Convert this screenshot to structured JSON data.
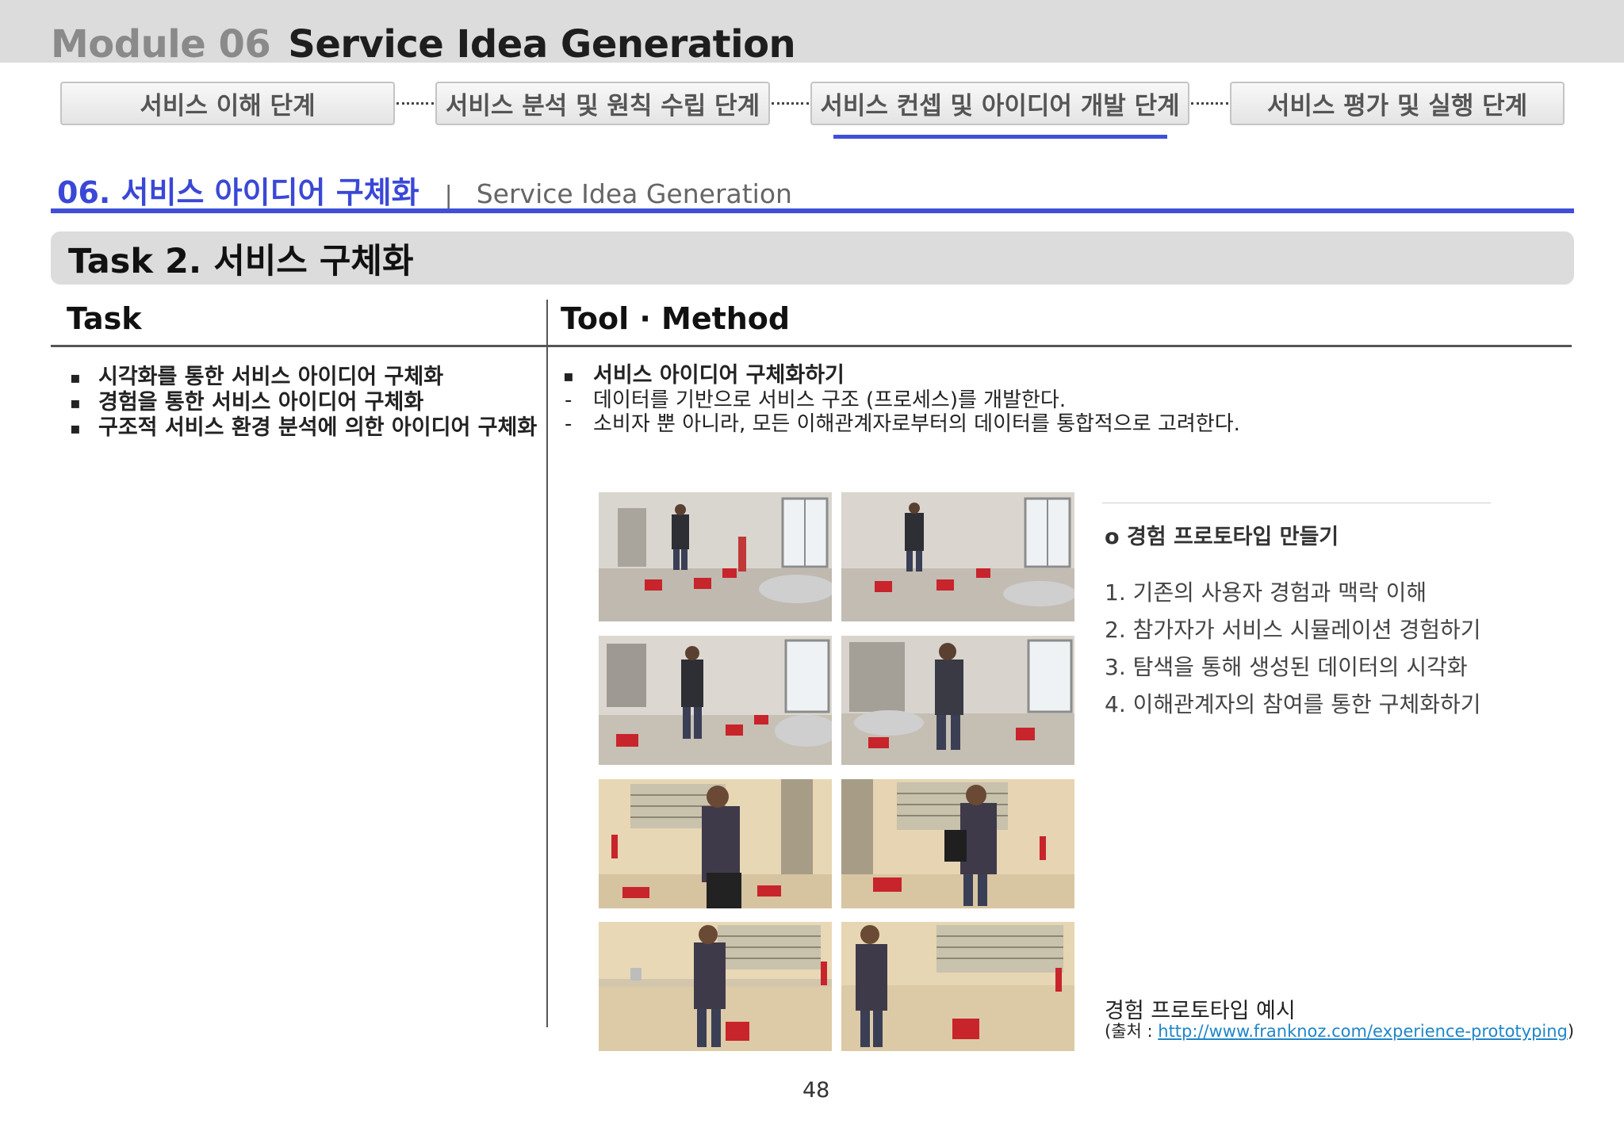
{
  "header": {
    "module_number": "Module 06",
    "module_name": "Service Idea Generation"
  },
  "process_steps": [
    {
      "label": "서비스 이해 단계",
      "active": false
    },
    {
      "label": "서비스 분석 및 원칙 수립 단계",
      "active": false
    },
    {
      "label": "서비스 컨셉 및 아이디어 개발 단계",
      "active": true
    },
    {
      "label": "서비스 평가 및 실행 단계",
      "active": false
    }
  ],
  "section": {
    "title": "06. 서비스 아이디어 구체화",
    "separator": "|",
    "subtitle": "Service Idea Generation"
  },
  "task_bar": {
    "title": "Task 2. 서비스 구체화"
  },
  "columns": {
    "task": "Task",
    "tool_method": "Tool · Method"
  },
  "tasks": [
    "시각화를 통한 서비스 아이디어 구체화",
    "경험을 통한 서비스 아이디어 구체화",
    "구조적 서비스 환경 분석에 의한 아이디어 구체화"
  ],
  "tool": {
    "heading": "서비스 아이디어 구체화하기",
    "details": [
      "데이터를 기반으로 서비스 구조 (프로세스)를 개발한다.",
      "소비자 뿐 아니라, 모든 이해관계자로부터의 데이터를 통합적으로 고려한다."
    ]
  },
  "prototype": {
    "title": "o 경험 프로토타입 만들기",
    "steps": [
      "1. 기존의 사용자 경험과 맥락 이해",
      "2. 참가자가 서비스 시뮬레이션 경험하기",
      "3. 탐색을 통해 생성된 데이터의 시각화",
      "4. 이해관계자의 참여를 통한 구체화하기"
    ]
  },
  "caption": {
    "title": "경험 프로토타입 예시",
    "source_prefix": "(출처 : ",
    "source_link": "http://www.franknoz.com/experience-prototyping",
    "source_suffix": ")"
  },
  "page_number": "48",
  "colors": {
    "accent_blue": "#3f4fd8",
    "link_blue": "#1f86c8",
    "header_gray": "#dcdcdc",
    "chair_red": "#c8242b"
  }
}
